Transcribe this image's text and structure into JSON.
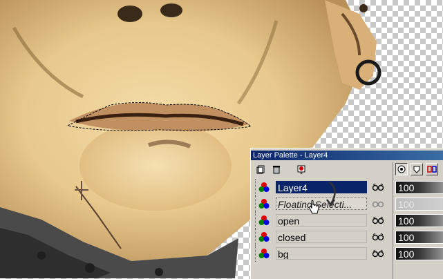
{
  "palette": {
    "title": "Layer Palette - Layer4",
    "layers": [
      {
        "name": "Layer4",
        "selected": true,
        "opacity": "100"
      },
      {
        "name": "Floating Selecti...",
        "floating": true,
        "opacity": "100"
      },
      {
        "name": "open",
        "opacity": "100"
      },
      {
        "name": "closed",
        "opacity": "100"
      },
      {
        "name": "bg",
        "opacity": "100"
      }
    ]
  },
  "colors": {
    "titlebar": "#0a246a",
    "selected_row": "#0a246a",
    "panel": "#d4d0c8",
    "skin": "#e8c88c"
  },
  "icons": [
    "new-layer-icon",
    "delete-layer-icon",
    "mask-icon",
    "layer-visibility-icon",
    "transparency-lock-icon",
    "layer-type-icon",
    "hand-cursor-icon",
    "drag-arrow-icon"
  ]
}
